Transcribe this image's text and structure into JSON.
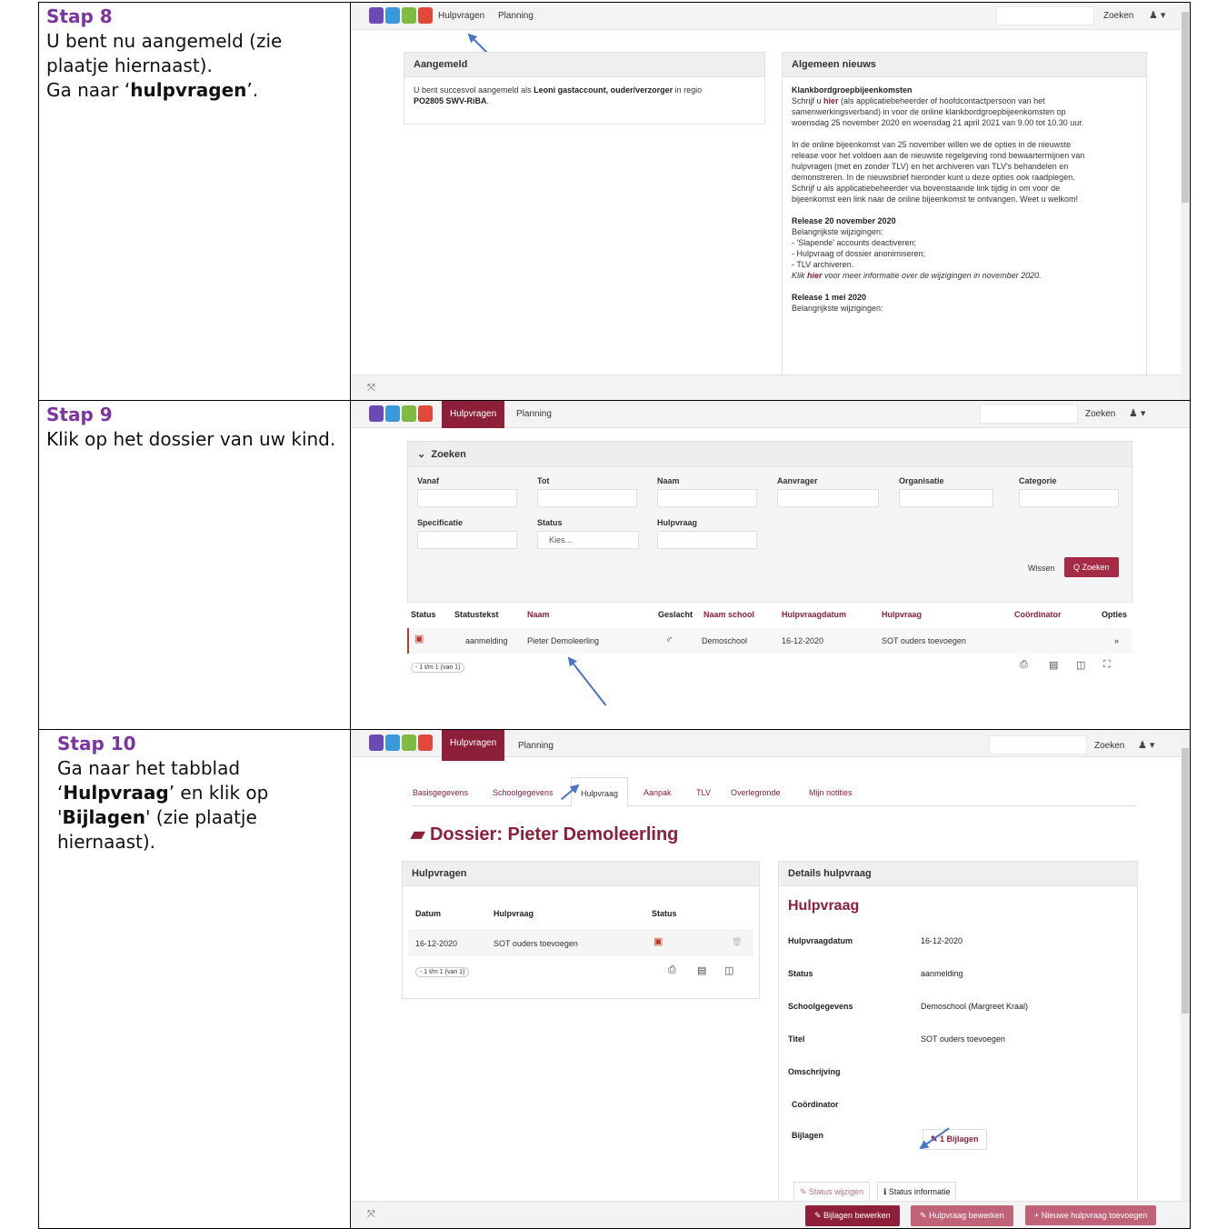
{
  "steps": [
    {
      "heading": "Stap 8",
      "lines": [
        "U bent nu aangemeld (zie",
        "plaatje hiernaast)."
      ],
      "pre": "Ga naar ‘",
      "bold": "hulpvragen",
      "post": "’."
    },
    {
      "heading": "Stap 9",
      "text": "Klik op het dossier van uw kind."
    },
    {
      "heading": "Stap 10",
      "a1": "Ga naar het tabblad",
      "a2": "‘",
      "b1": "Hulpvraag",
      "a3": "’ en klik op",
      "a4": "'",
      "b2": "Bijlagen",
      "a5": "' (zie plaatje",
      "a6": "hiernaast)."
    }
  ],
  "nav": {
    "hulpvragen": "Hulpvragen",
    "planning": "Planning",
    "zoeken": "Zoeken",
    "user": "♟ ▾"
  },
  "shot1": {
    "aangemeld_title": "Aangemeld",
    "aangemeld_pre": "U bent succesvol aangemeld als ",
    "aangemeld_bold": "Leoni gastaccount, ouder/verzorger",
    "aangemeld_mid": " in regio",
    "aangemeld_region": "PO2805 SWV-RiBA",
    "aangemeld_end": ".",
    "nieuws_title": "Algemeen nieuws",
    "kb_title": "Klankbordgroepbijeenkomsten",
    "kb_1a": "Schrijf u ",
    "kb_hier": "hier",
    "kb_1b": " (als applicatiebeheerder of hoofdcontactpersoon van het",
    "kb_2": "samenwerkingsverband) in voor de online klankbordgroepbijeenkomsten op",
    "kb_3": "woensdag 25 november 2020 en woensdag 21 april 2021 van 9.00 tot 10.30 uur.",
    "p2": [
      "In de online bijeenkomst van 25 november willen we de opties in de nieuwste",
      "release voor het voldoen aan de nieuwste regelgeving rond bewaartermijnen van",
      "hulpvragen (met en zonder TLV) en het archiveren van TLV's behandelen en",
      "demonstreren. In de nieuwsbrief hieronder kunt u deze opties ook raadplegen.",
      "Schrijf u als applicatiebeheerder via bovenstaande link tijdig in om voor de",
      "bijeenkomst een link naar de online bijeenkomst te ontvangen. Weet u welkom!"
    ],
    "rel1_title": "Release 20 november 2020",
    "rel1_lines": [
      "Belangrijkste wijzigingen:",
      "- 'Slapende' accounts deactiveren;",
      "- Hulpvraag of dossier anonimiseren;",
      "- TLV archiveren."
    ],
    "rel1_klik": "Klik ",
    "rel1_hier": "hier",
    "rel1_rest": " voor meer informatie over de wijzigingen in november 2020.",
    "rel2_title": "Release 1 mei 2020",
    "rel2_line": "Belangrijkste wijzigingen:"
  },
  "shot2": {
    "zoeken_header": "Zoeken",
    "chev": "⌄",
    "fields": [
      "Vanaf",
      "Tot",
      "Naam",
      "Aanvrager",
      "Organisatie",
      "Categorie",
      "Specificatie",
      "Status",
      "Hulpvraag"
    ],
    "status_select": "Kies...",
    "wissen": "Wissen",
    "zoeken_btn": "Q Zoeken",
    "cols": [
      "Status",
      "Statustekst",
      "Naam",
      "Geslacht",
      "Naam school",
      "Hulpvraagdatum",
      "Hulpvraag",
      "Coördinator",
      "Opties"
    ],
    "row": {
      "statustekst": "aanmelding",
      "naam": "Pieter Demoleerling",
      "geslacht": "♂",
      "school": "Demoschool",
      "datum": "16-12-2020",
      "hulpvraag": "SOT ouders toevoegen",
      "opties": "»"
    },
    "pager": "- 1 t/m 1 (van 1)"
  },
  "shot3": {
    "tabs": [
      "Basisgegevens",
      "Schoolgegevens",
      "Hulpvraag",
      "Aanpak",
      "TLV",
      "Overlegronde",
      "Mijn notities"
    ],
    "dossier_title": "Dossier: Pieter Demoleerling",
    "hulpvragen_title": "Hulpvragen",
    "cols": [
      "Datum",
      "Hulpvraag",
      "Status"
    ],
    "row": {
      "datum": "16-12-2020",
      "hulpvraag": "SOT ouders toevoegen"
    },
    "pager": "- 1 t/m 1 (van 1)",
    "details_title": "Details hulpvraag",
    "hulpvraag_heading": "Hulpvraag",
    "details": [
      {
        "k": "Hulpvraagdatum",
        "v": "16-12-2020"
      },
      {
        "k": "Status",
        "v": "aanmelding"
      },
      {
        "k": "Schoolgegevens",
        "v": "Demoschool (Margreet Kraal)"
      },
      {
        "k": "Titel",
        "v": "SOT ouders toevoegen"
      },
      {
        "k": "Omschrijving",
        "v": ""
      },
      {
        "k": "Coördinator",
        "v": ""
      },
      {
        "k": "Bijlagen",
        "v": ""
      }
    ],
    "bijlagen_btn": "✎ 1 Bijlagen",
    "status_wijzigen": "✎ Status wijzigen",
    "status_informatie": "ℹ Status informatie",
    "btn_bijlagen": "✎ Bijlagen bewerken",
    "btn_hulpvraag": "✎ Hulpvraag bewerken",
    "btn_nieuw": "+ Nieuwe hulpvraag toevoegen"
  }
}
